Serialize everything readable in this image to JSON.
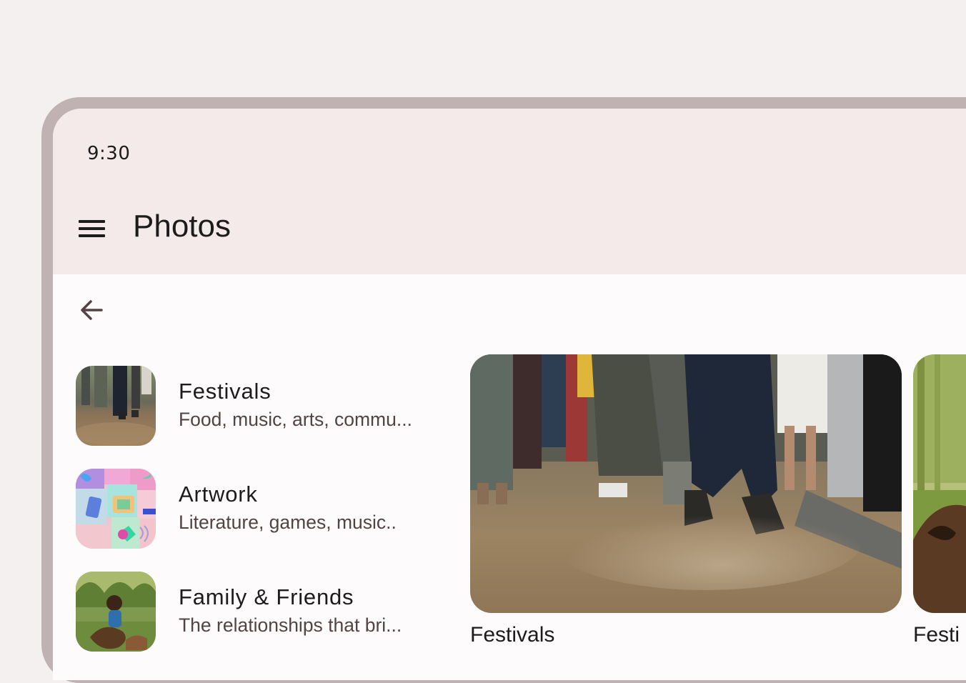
{
  "status_bar": {
    "time": "9:30"
  },
  "app_bar": {
    "title": "Photos",
    "menu_icon": "menu-icon"
  },
  "nav": {
    "back_icon": "arrow-back-icon"
  },
  "albums": [
    {
      "title": "Festivals",
      "subtitle": "Food, music, arts, commu..."
    },
    {
      "title": "Artwork",
      "subtitle": "Literature, games, music.."
    },
    {
      "title": "Family & Friends",
      "subtitle": "The relationships that bri..."
    }
  ],
  "detail": {
    "captions": [
      "Festivals",
      "Festi"
    ]
  },
  "colors": {
    "app_bar_bg": "#f4eaea",
    "surface": "#fdfbfb",
    "frame": "#c0b2b2",
    "on_surface": "#1d1b1c",
    "on_surface_variant": "#524345"
  }
}
